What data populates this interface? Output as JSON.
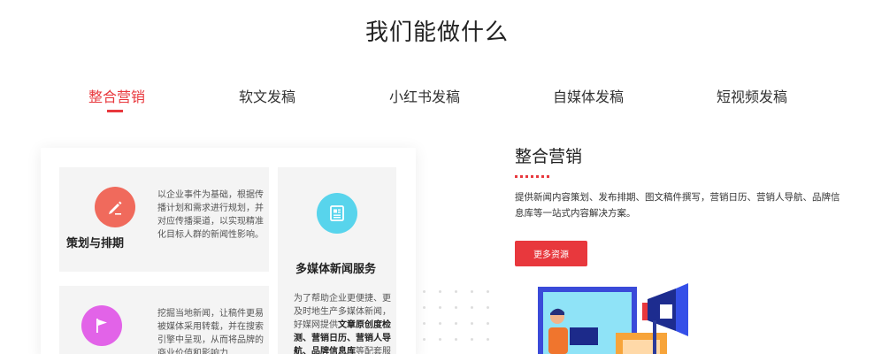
{
  "section": {
    "title": "我们能做什么"
  },
  "tabs": [
    {
      "label": "整合营销",
      "active": true
    },
    {
      "label": "软文发稿",
      "active": false
    },
    {
      "label": "小红书发稿",
      "active": false
    },
    {
      "label": "自媒体发稿",
      "active": false
    },
    {
      "label": "短视频发稿",
      "active": false
    }
  ],
  "features": {
    "planning": {
      "title": "策划与排期",
      "desc": "以企业事件为基础，根据传播计划和需求进行规划，并对应传播渠道，以实现精准化目标人群的新闻性影响。",
      "icon": "pen-icon",
      "color": "#f06a5c"
    },
    "media": {
      "title": "多媒体新闻服务",
      "desc_parts": [
        "为了帮助企业更便捷、更及时地生产多媒体新闻，好媒网提供",
        "文章原创度检测、营销日历、营销人导航、品牌信息库",
        "等配套服务。"
      ],
      "icon": "document-icon",
      "color": "#58d4ec"
    },
    "hotnews": {
      "title": "",
      "desc": "挖掘当地新闻，让稿件更易被媒体采用转载，并在搜索引擎中呈现，从而将品牌的商业价值和影响力",
      "icon": "flag-icon",
      "color": "#e263e8"
    }
  },
  "detail": {
    "title": "整合营销",
    "desc": "提供新闻内容策划、发布排期、图文稿件撰写，营销日历、营销人导航、品牌信息库等一站式内容解决方案。",
    "button_label": "更多资源"
  },
  "colors": {
    "accent": "#e8383d",
    "card_bg": "#f4f4f4"
  }
}
